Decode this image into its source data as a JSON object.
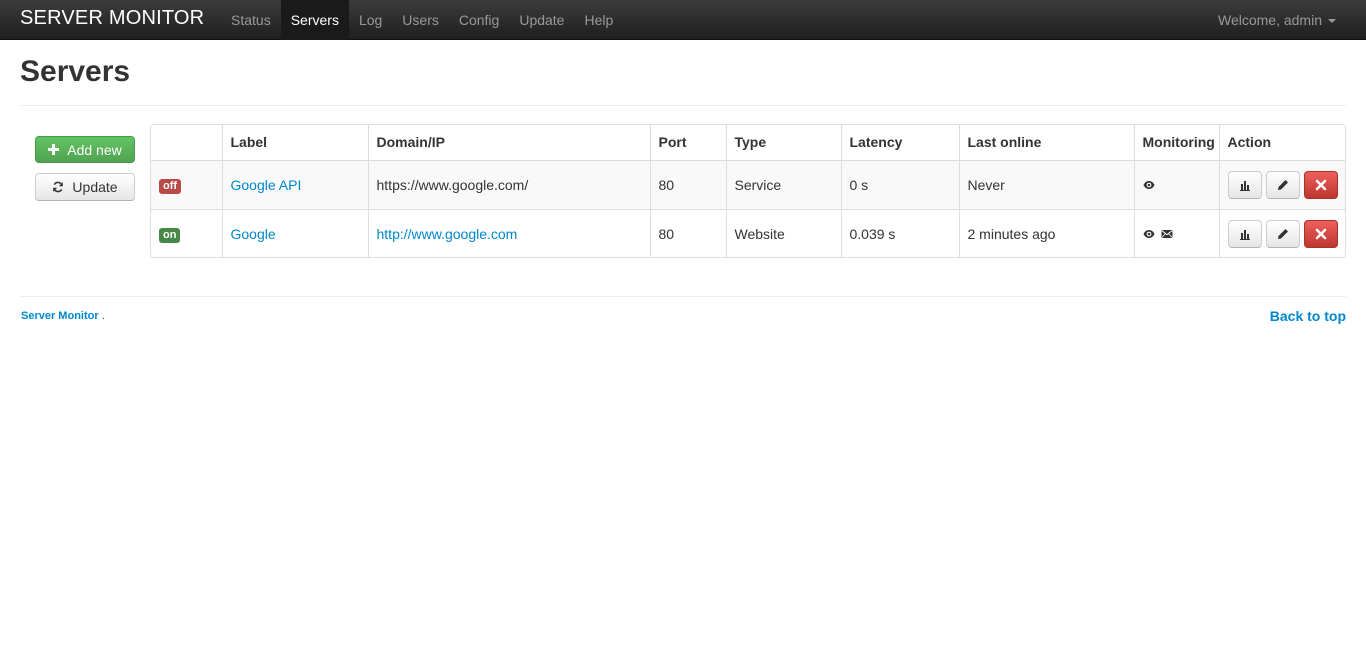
{
  "navbar": {
    "brand": "SERVER MONITOR",
    "items": [
      {
        "label": "Status",
        "active": false
      },
      {
        "label": "Servers",
        "active": true
      },
      {
        "label": "Log",
        "active": false
      },
      {
        "label": "Users",
        "active": false
      },
      {
        "label": "Config",
        "active": false
      },
      {
        "label": "Update",
        "active": false
      },
      {
        "label": "Help",
        "active": false
      }
    ],
    "welcome": "Welcome, admin"
  },
  "page": {
    "title": "Servers"
  },
  "sidebar": {
    "add_label": "Add new",
    "update_label": "Update"
  },
  "table": {
    "headers": [
      "",
      "Label",
      "Domain/IP",
      "Port",
      "Type",
      "Latency",
      "Last online",
      "Monitoring",
      "Action"
    ],
    "rows": [
      {
        "status": "off",
        "label": "Google API",
        "domain": "https://www.google.com/",
        "port": "80",
        "type": "Service",
        "latency": "0 s",
        "last_online": "Never",
        "monitoring_icons": [
          "eye-icon"
        ]
      },
      {
        "status": "on",
        "label": "Google",
        "domain": "http://www.google.com",
        "port": "80",
        "type": "Website",
        "latency": "0.039 s",
        "last_online": "2 minutes ago",
        "monitoring_icons": [
          "eye-icon",
          "mail-icon"
        ]
      }
    ]
  },
  "footer": {
    "brand": "Server Monitor",
    "dot": ".",
    "back_to_top": "Back to top"
  },
  "colors": {
    "link": "#0088cc",
    "success": "#51a351",
    "danger": "#bd362f",
    "status_off": "#b94a48",
    "status_on": "#468847"
  }
}
